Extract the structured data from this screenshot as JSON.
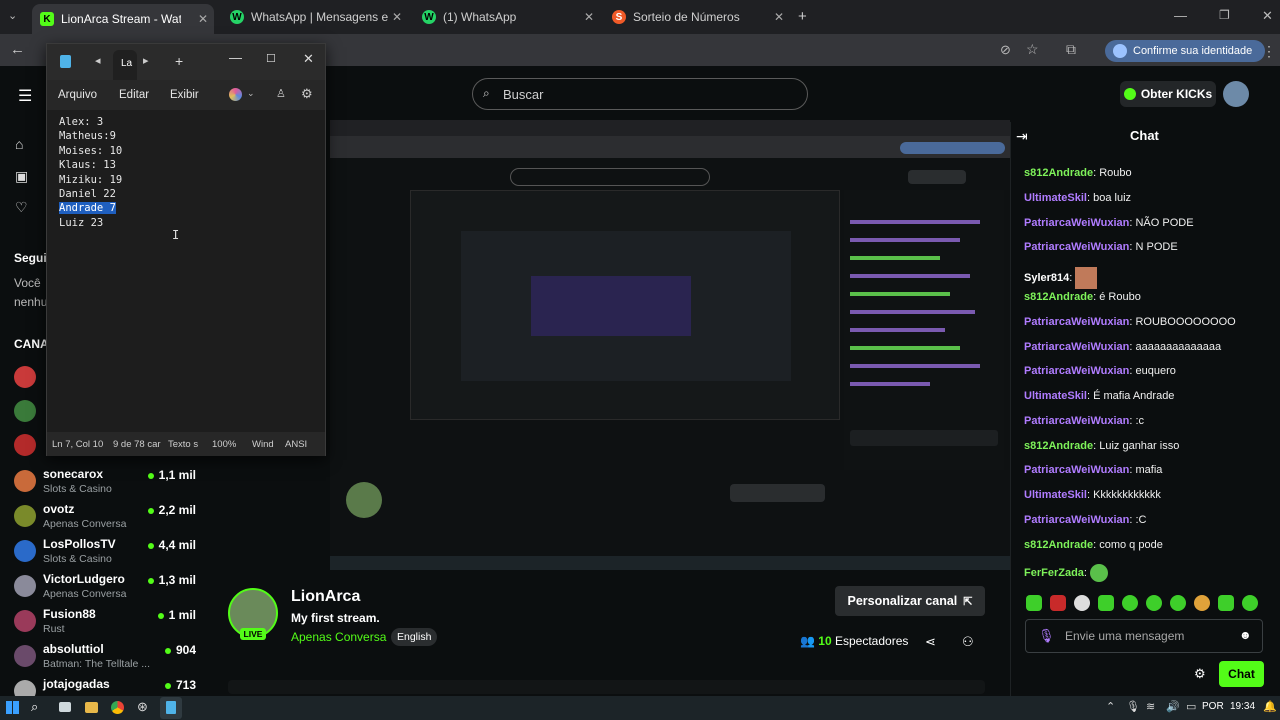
{
  "browser": {
    "tabs": [
      {
        "label": "LionArca Stream - Watch Li",
        "fav": "K",
        "fav_color": "#53fc18",
        "active": true
      },
      {
        "label": "WhatsApp | Mensagens e ligaç",
        "fav": "W",
        "fav_color": "#25d366",
        "active": false
      },
      {
        "label": "(1) WhatsApp",
        "fav": "W",
        "fav_color": "#25d366",
        "active": false
      },
      {
        "label": "Sorteio de Números",
        "fav": "S",
        "fav_color": "#f05a28",
        "active": false
      }
    ],
    "confirm_identity": "Confirme sua identidade"
  },
  "kick": {
    "search_placeholder": "Buscar",
    "obter_kicks": "Obter KICKs",
    "sidebar": {
      "following_title": "Segui",
      "following_text_1": "Você",
      "following_text_2": "nenhu",
      "channels_title": "CANA",
      "channels": [
        {
          "name": "sonecarox",
          "category": "Slots & Casino",
          "viewers": "1,1 mil",
          "color": "#c96a3a"
        },
        {
          "name": "ovotz",
          "category": "Apenas Conversa",
          "viewers": "2,2 mil",
          "color": "#7a8a2a"
        },
        {
          "name": "LosPollosTV",
          "category": "Slots & Casino",
          "viewers": "4,4 mil",
          "color": "#2a6ac9"
        },
        {
          "name": "VictorLudgero",
          "category": "Apenas Conversa",
          "viewers": "1,3 mil",
          "color": "#8a8a9a"
        },
        {
          "name": "Fusion88",
          "category": "Rust",
          "viewers": "1 mil",
          "color": "#9a3a5a"
        },
        {
          "name": "absoluttiol",
          "category": "Batman: The Telltale ...",
          "viewers": "904",
          "color": "#6a4a6a"
        },
        {
          "name": "jotajogadas",
          "category": "",
          "viewers": "713",
          "color": "#aaaaaa"
        }
      ]
    },
    "stream": {
      "channel": "LionArca",
      "title": "My first stream.",
      "category": "Apenas Conversa",
      "language": "English",
      "live_badge": "LIVE",
      "customize": "Personalizar canal",
      "viewers_count": "10",
      "viewers_label": "Espectadores"
    },
    "chat": {
      "title": "Chat",
      "messages": [
        {
          "user": "s812Andrade",
          "color": "#7ef25a",
          "text": "Roubo"
        },
        {
          "user": "UltimateSkil",
          "color": "#b07cff",
          "text": "boa luiz"
        },
        {
          "user": "PatriarcaWeiWuxian",
          "color": "#b07cff",
          "text": "NÃO PODE"
        },
        {
          "user": "PatriarcaWeiWuxian",
          "color": "#b07cff",
          "text": "N PODE"
        },
        {
          "user": "Syler814",
          "color": "#ffffff",
          "text": "[emote]"
        },
        {
          "user": "s812Andrade",
          "color": "#7ef25a",
          "text": "é Roubo"
        },
        {
          "user": "PatriarcaWeiWuxian",
          "color": "#b07cff",
          "text": "ROUBOOOOOOOO"
        },
        {
          "user": "PatriarcaWeiWuxian",
          "color": "#b07cff",
          "text": "aaaaaaaaaaaaaa"
        },
        {
          "user": "PatriarcaWeiWuxian",
          "color": "#b07cff",
          "text": "euquero"
        },
        {
          "user": "UltimateSkil",
          "color": "#b07cff",
          "text": "É mafia Andrade"
        },
        {
          "user": "PatriarcaWeiWuxian",
          "color": "#b07cff",
          "text": ":c"
        },
        {
          "user": "s812Andrade",
          "color": "#7ef25a",
          "text": "Luiz ganhar isso"
        },
        {
          "user": "PatriarcaWeiWuxian",
          "color": "#b07cff",
          "text": "mafia"
        },
        {
          "user": "UltimateSkil",
          "color": "#b07cff",
          "text": "Kkkkkkkkkkkk"
        },
        {
          "user": "PatriarcaWeiWuxian",
          "color": "#b07cff",
          "text": ":C"
        },
        {
          "user": "s812Andrade",
          "color": "#7ef25a",
          "text": "como q pode"
        },
        {
          "user": "FerFerZada",
          "color": "#7ef25a",
          "text": "[emote]"
        }
      ],
      "input_placeholder": "Envie uma mensagem",
      "send_label": "Chat"
    }
  },
  "notepad": {
    "tab_label": "La",
    "menu": [
      "Arquivo",
      "Editar",
      "Exibir"
    ],
    "lines": [
      "Alex: 3",
      "Matheus:9",
      "Moises: 10",
      "Klaus: 13",
      "Miziku: 19",
      "Daniel 22",
      "Andrade 7",
      "Luiz 23"
    ],
    "selected_line": 6,
    "status": {
      "position": "Ln 7, Col 10",
      "chars": "9 de 78 car",
      "mode": "Texto s",
      "zoom": "100%",
      "eol": "Wind",
      "encoding": "ANSI"
    }
  },
  "taskbar": {
    "lang": "POR",
    "time": "19:34"
  }
}
